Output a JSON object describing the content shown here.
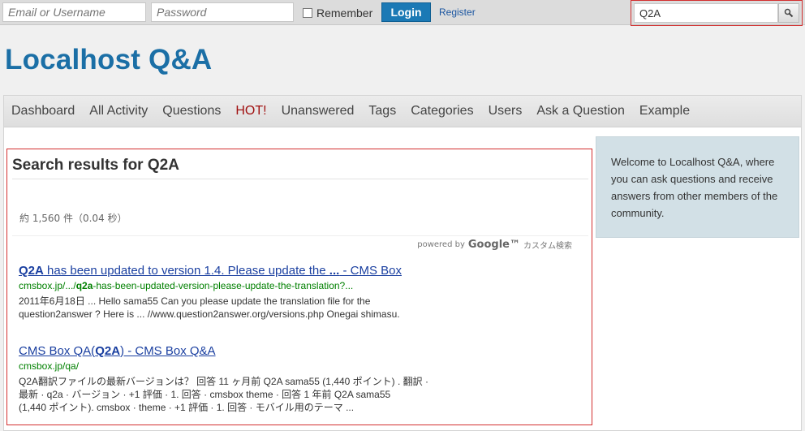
{
  "topbar": {
    "username_placeholder": "Email or Username",
    "password_placeholder": "Password",
    "remember_label": "Remember",
    "login_label": "Login",
    "register_label": "Register",
    "search_value": "Q2A"
  },
  "site": {
    "title": "Localhost Q&A"
  },
  "nav": {
    "items": [
      {
        "label": "Dashboard"
      },
      {
        "label": "All Activity"
      },
      {
        "label": "Questions"
      },
      {
        "label": "HOT!"
      },
      {
        "label": "Unanswered"
      },
      {
        "label": "Tags"
      },
      {
        "label": "Categories"
      },
      {
        "label": "Users"
      },
      {
        "label": "Ask a Question"
      },
      {
        "label": "Example"
      }
    ]
  },
  "results": {
    "heading": "Search results for Q2A",
    "count_text": "約 1,560 件（0.04 秒）",
    "powered_by": "powered by",
    "powered_brand": "Google™",
    "custom_search": "カスタム検索",
    "items": [
      {
        "title_bold": "Q2A",
        "title_rest": " has been updated to version 1.4. Please update the ",
        "title_bold2": "...",
        "title_tail": " - CMS Box",
        "url_pre": "cmsbox.jp/.../",
        "url_bold": "q2a",
        "url_post": "-has-been-updated-version-please-update-the-translation?...",
        "snippet_line1": "2011年6月18日 ... Hello sama55 Can you please update the translation file for the",
        "snippet_line2": "question2answer ? Here is ... //www.question2answer.org/versions.php Onegai shimasu."
      },
      {
        "title_pre": "CMS Box QA(",
        "title_bold": "Q2A",
        "title_tail": ") - CMS Box Q&A",
        "url": "cmsbox.jp/qa/",
        "snippet_line1": "Q2A翻訳ファイルの最新バージョンは？ 回答 11 ヶ月前 Q2A sama55 (1,440 ポイント) . 翻訳 ·",
        "snippet_line2": "最新 · q2a · バージョン · +1 評価 · 1. 回答 · cmsbox theme · 回答 1 年前 Q2A sama55",
        "snippet_line3": "(1,440 ポイント). cmsbox · theme · +1 評価 · 1. 回答 · モバイル用のテーマ ..."
      }
    ]
  },
  "sidebar": {
    "welcome": "Welcome to Localhost Q&A, where you can ask questions and receive answers from other members of the community."
  }
}
